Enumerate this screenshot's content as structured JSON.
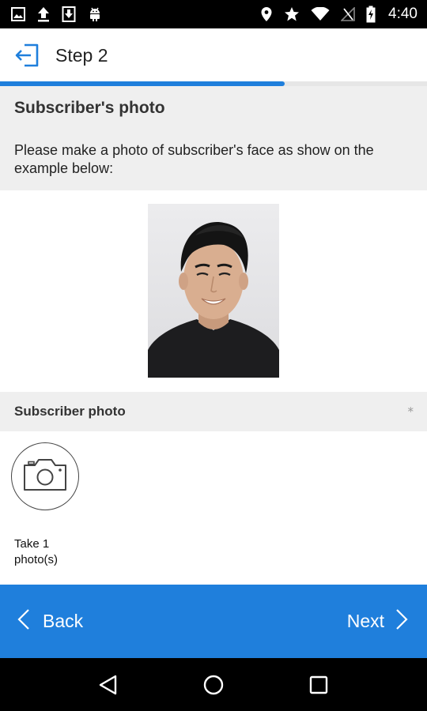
{
  "status_bar": {
    "time": "4:40",
    "left_icons": [
      "image-icon",
      "upload-icon",
      "download-icon",
      "android-icon"
    ],
    "right_icons": [
      "location-icon",
      "star-icon",
      "wifi-icon",
      "no-signal-icon",
      "battery-charging-icon"
    ]
  },
  "app_bar": {
    "title": "Step 2",
    "exit_icon": "exit-icon"
  },
  "progress": {
    "fraction": 0.667,
    "color": "#1f7fdc"
  },
  "info": {
    "title": "Subscriber's photo",
    "description": "Please make a photo of subscriber's face as show on the example below:"
  },
  "example": {
    "image_icon": "example-portrait-image"
  },
  "field": {
    "label": "Subscriber photo",
    "required_mark": "*",
    "camera_icon": "camera-icon",
    "hint": "Take 1 photo(s)"
  },
  "actions": {
    "back_label": "Back",
    "next_label": "Next",
    "color": "#1f7fdc"
  },
  "nav": {
    "icons": [
      "back-triangle-icon",
      "home-circle-icon",
      "recents-square-icon"
    ]
  }
}
